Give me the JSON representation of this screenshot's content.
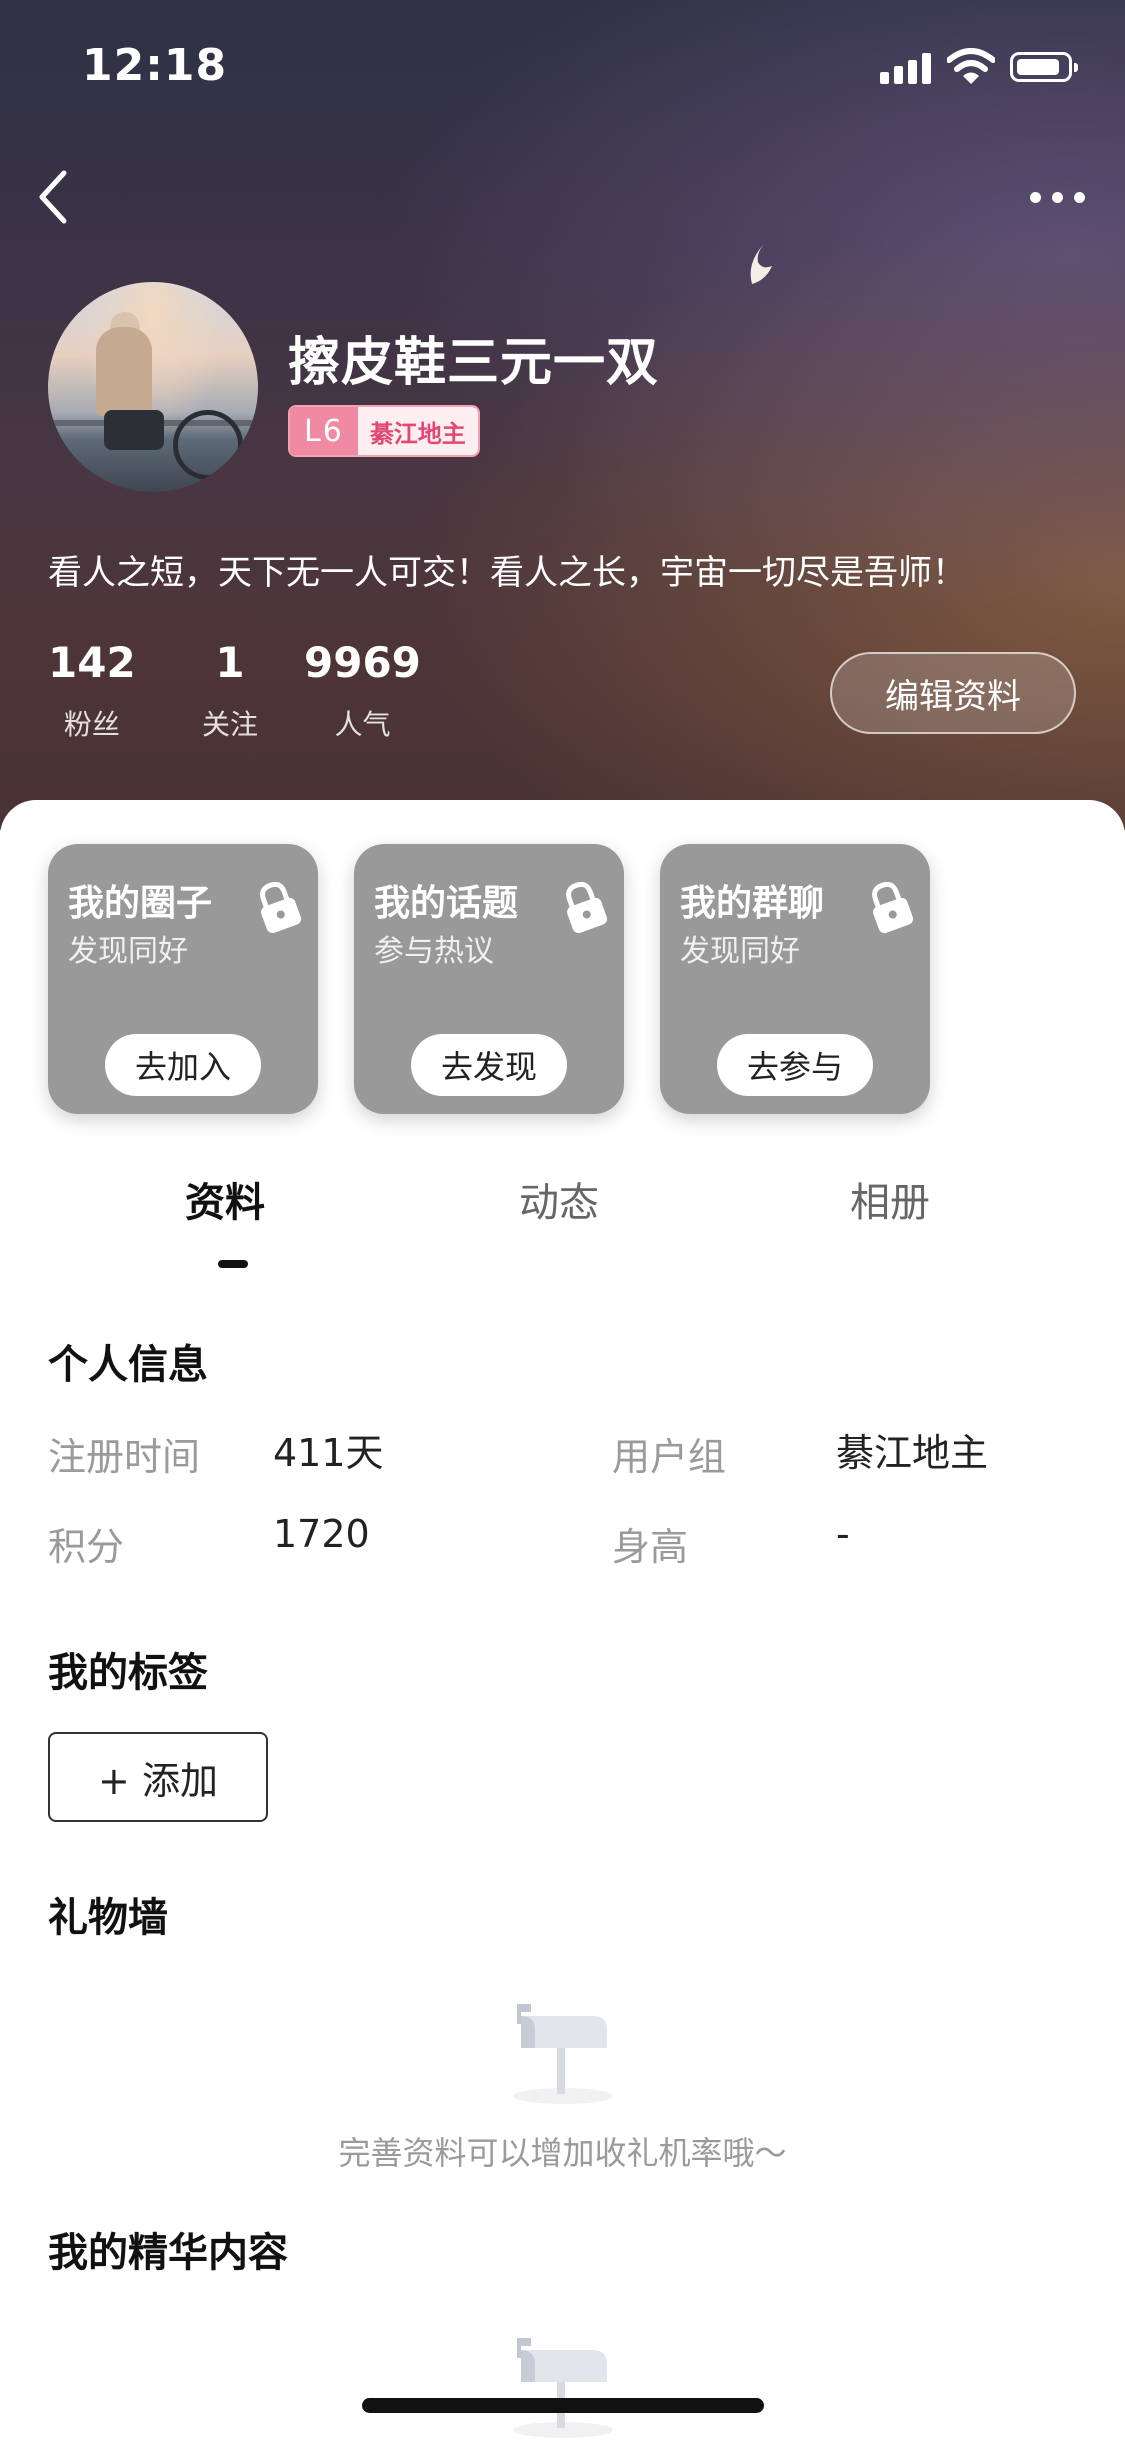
{
  "status_bar": {
    "time": "12:18"
  },
  "profile": {
    "username": "擦皮鞋三元一双",
    "level": "L6",
    "level_title": "綦江地主",
    "bio": "看人之短，天下无一人可交！看人之长，宇宙一切尽是吾师！",
    "stats": [
      {
        "value": "142",
        "label": "粉丝"
      },
      {
        "value": "1",
        "label": "关注"
      },
      {
        "value": "9969",
        "label": "人气"
      }
    ],
    "edit_label": "编辑资料"
  },
  "cards": [
    {
      "title": "我的圈子",
      "subtitle": "发现同好",
      "button": "去加入"
    },
    {
      "title": "我的话题",
      "subtitle": "参与热议",
      "button": "去发现"
    },
    {
      "title": "我的群聊",
      "subtitle": "发现同好",
      "button": "去参与"
    }
  ],
  "tabs": [
    {
      "label": "资料",
      "active": true
    },
    {
      "label": "动态",
      "active": false
    },
    {
      "label": "相册",
      "active": false
    }
  ],
  "personal_info": {
    "title": "个人信息",
    "fields": [
      {
        "label": "注册时间",
        "value": "411天"
      },
      {
        "label": "用户组",
        "value": "綦江地主"
      },
      {
        "label": "积分",
        "value": "1720"
      },
      {
        "label": "身高",
        "value": "-"
      }
    ]
  },
  "tags": {
    "title": "我的标签",
    "add_label": "+ 添加"
  },
  "gift_wall": {
    "title": "礼物墙",
    "empty_text": "完善资料可以增加收礼机率哦～"
  },
  "featured": {
    "title": "我的精华内容"
  },
  "colors": {
    "card_bg": "#999999",
    "level_pink": "#f08aa2",
    "level_title_text": "#e04a72",
    "label_gray": "#9a9a9a"
  },
  "icons": [
    "back-icon",
    "more-icon",
    "signal-icon",
    "wifi-icon",
    "battery-icon",
    "lock-icon",
    "mailbox-icon",
    "moon-icon"
  ]
}
